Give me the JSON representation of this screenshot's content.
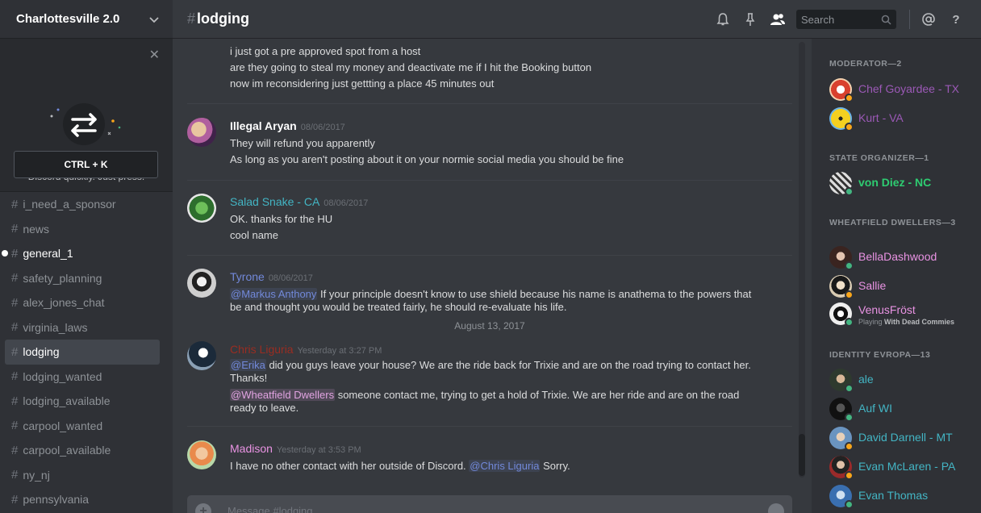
{
  "server": {
    "name": "Charlottesville 2.0"
  },
  "quick_switcher": {
    "text": "Use Quick Switcher to get around Discord quickly. Just press:",
    "shortcut": "CTRL + K"
  },
  "channels": [
    {
      "name": "i_need_a_sponsor",
      "state": "normal"
    },
    {
      "name": "news",
      "state": "normal"
    },
    {
      "name": "general_1",
      "state": "unread"
    },
    {
      "name": "safety_planning",
      "state": "normal"
    },
    {
      "name": "alex_jones_chat",
      "state": "normal"
    },
    {
      "name": "virginia_laws",
      "state": "normal"
    },
    {
      "name": "lodging",
      "state": "active"
    },
    {
      "name": "lodging_wanted",
      "state": "normal"
    },
    {
      "name": "lodging_available",
      "state": "normal"
    },
    {
      "name": "carpool_wanted",
      "state": "normal"
    },
    {
      "name": "carpool_available",
      "state": "normal"
    },
    {
      "name": "ny_nj",
      "state": "normal"
    },
    {
      "name": "pennsylvania",
      "state": "normal"
    }
  ],
  "header": {
    "hash": "#",
    "channel": "lodging",
    "search_placeholder": "Search"
  },
  "messages": {
    "continued": {
      "lines": [
        "i just got a pre approved spot from a host",
        "are they going to steal my money and deactivate me if I hit the Booking button",
        "now im reconsidering just gettting a place 45 minutes out"
      ]
    },
    "illegal_aryan": {
      "author": "Illegal Aryan",
      "color": "#ffffff",
      "time": "08/06/2017",
      "lines": [
        "They will refund you apparently",
        "As long as you aren't posting about it on your normie social media you should be fine"
      ]
    },
    "salad_snake": {
      "author": "Salad Snake - CA",
      "color": "#43b5c4",
      "time": "08/06/2017",
      "lines": [
        "OK. thanks for the HU",
        "cool name"
      ]
    },
    "tyrone": {
      "author": "Tyrone",
      "color": "#7289da",
      "time": "08/06/2017",
      "mention": "@Markus Anthony",
      "text": " If your principle doesn't know to use shield because his name is anathema to the powers that be and thought you would be treated fairly, he should re-evaluate his life."
    },
    "date_separator": "August 13, 2017",
    "chris": {
      "author": "Chris Liguria",
      "color": "#992d22",
      "time": "Yesterday at 3:27 PM",
      "mention1": "@Erika",
      "text1": "  did you guys leave your house? We are the ride back for Trixie and are on the road trying to contact her. Thanks!",
      "mention2": "@Wheatfield Dwellers",
      "text2": "  someone contact me, trying to get a hold of Trixie. We are her ride and are on the road ready to leave."
    },
    "madison": {
      "author": "Madison",
      "color": "#e993e3",
      "time": "Yesterday at 3:53 PM",
      "text": "I have no other contact with her outside of Discord. ",
      "mention": "@Chris Liguria",
      "text_after": " Sorry."
    }
  },
  "composer": {
    "placeholder": "Message #lodging"
  },
  "members": {
    "moderator": {
      "header": "MODERATOR—2",
      "items": [
        {
          "name": "Chef Goyardee - TX",
          "color": "#9b59b6",
          "status": "idle"
        },
        {
          "name": "Kurt - VA",
          "color": "#9b59b6",
          "status": "idle"
        }
      ]
    },
    "state_organizer": {
      "header": "STATE ORGANIZER—1",
      "items": [
        {
          "name": "von Diez - NC",
          "color": "#2ecc71",
          "status": "online"
        }
      ]
    },
    "wheatfield": {
      "header": "WHEATFIELD DWELLERS—3",
      "items": [
        {
          "name": "BellaDashwood",
          "color": "#e993e3",
          "status": "online"
        },
        {
          "name": "Sallie",
          "color": "#e993e3",
          "status": "idle"
        },
        {
          "name": "VenusFröst",
          "color": "#e993e3",
          "status": "online",
          "activity_prefix": "Playing ",
          "activity": "With Dead Commies"
        }
      ]
    },
    "identity": {
      "header": "IDENTITY EVROPA—13",
      "items": [
        {
          "name": "ale",
          "color": "#43b5c4",
          "status": "online"
        },
        {
          "name": "Auf WI",
          "color": "#43b5c4",
          "status": "online"
        },
        {
          "name": "David Darnell - MT",
          "color": "#43b5c4",
          "status": "idle"
        },
        {
          "name": "Evan McLaren - PA",
          "color": "#43b5c4",
          "status": "idle"
        },
        {
          "name": "Evan Thomas",
          "color": "#43b5c4",
          "status": "online"
        }
      ]
    }
  },
  "status_colors": {
    "online": "#43b581",
    "idle": "#faa61a"
  }
}
